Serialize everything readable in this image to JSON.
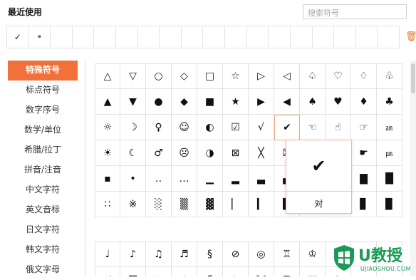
{
  "header": {
    "title": "最近使用",
    "search_placeholder": "搜索符号"
  },
  "recent": [
    "✓",
    "⁍",
    "",
    "",
    "",
    "",
    "",
    "",
    "",
    "",
    "",
    "",
    "",
    "",
    "",
    "",
    "",
    ""
  ],
  "sidebar": {
    "items": [
      {
        "label": "特殊符号",
        "active": true
      },
      {
        "label": "标点符号"
      },
      {
        "label": "数字序号"
      },
      {
        "label": "数学/单位"
      },
      {
        "label": "希腊/拉丁"
      },
      {
        "label": "拼音/注音"
      },
      {
        "label": "中文字符"
      },
      {
        "label": "英文音标"
      },
      {
        "label": "日文字符"
      },
      {
        "label": "韩文字符"
      },
      {
        "label": "俄文字母"
      }
    ]
  },
  "grid": [
    [
      "△",
      "▽",
      "○",
      "◇",
      "□",
      "☆",
      "▷",
      "◁",
      "♤",
      "♡",
      "♢",
      "♧"
    ],
    [
      "▲",
      "▼",
      "●",
      "◆",
      "■",
      "★",
      "▶",
      "◀",
      "♠",
      "♥",
      "♦",
      "♣"
    ],
    [
      "☼",
      "☽",
      "♀",
      "☺",
      "◐",
      "☑",
      "√",
      "✔",
      "☜",
      "☝",
      "☞",
      "㏂"
    ],
    [
      "☀",
      "☾",
      "♂",
      "☹",
      "◑",
      "⊠",
      "╳",
      "☒",
      "☚",
      "☛",
      "☛",
      "㏘"
    ],
    [
      "▪",
      "•",
      "‥",
      "…",
      "▁",
      "▂",
      "▃",
      "▄",
      "▅",
      "▆",
      "▇",
      "█"
    ],
    [
      "∷",
      "※",
      "░",
      "▒",
      "▓",
      "▏",
      "▎",
      "▍",
      "▌",
      "▋",
      "▊",
      "▉"
    ]
  ],
  "grid2": [
    [
      "♩",
      "♪",
      "♫",
      "♬",
      "§",
      "⊘",
      "◎",
      "♖",
      "♔",
      "✠",
      "",
      ""
    ],
    [
      "〆",
      "〓",
      "♭",
      "♯",
      "¶",
      "♮",
      "ℳ",
      "☎",
      "☏",
      "✈",
      "",
      ""
    ]
  ],
  "popup": {
    "symbol": "✔",
    "label": "对"
  },
  "watermark": {
    "brand": "U教授",
    "url": "UJIAOSHOU.COM"
  },
  "colors": {
    "accent": "#f2713a",
    "watermark": "#1a9a55"
  }
}
